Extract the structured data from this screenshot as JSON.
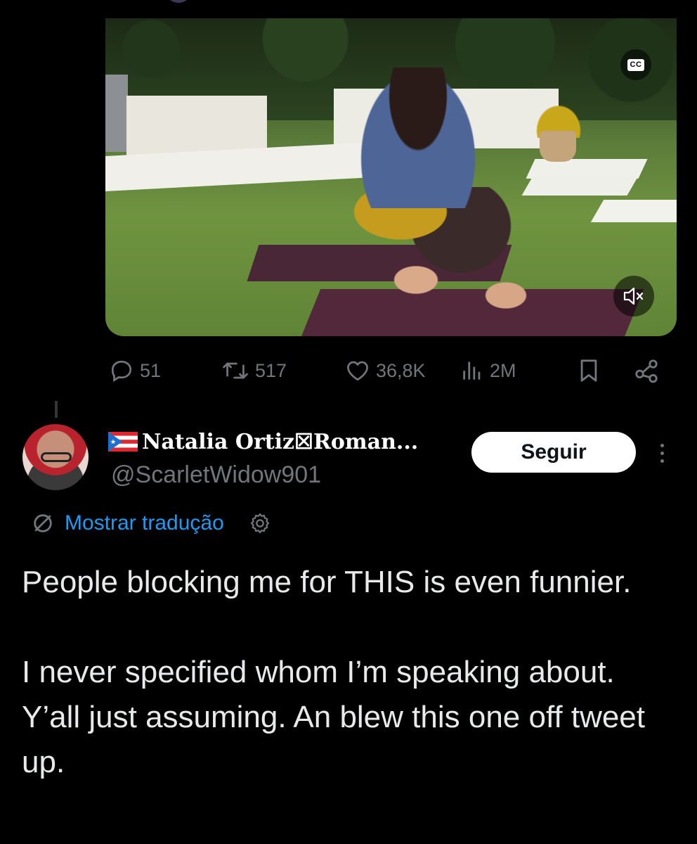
{
  "video": {
    "cc_label": "CC"
  },
  "actions": {
    "replies": "51",
    "reposts": "517",
    "likes": "36,8K",
    "views": "2M"
  },
  "reply": {
    "display_name": "Natalia Ortiz☒Roman...",
    "handle": "@ScarletWidow901",
    "follow_label": "Seguir",
    "translate_label": "Mostrar tradução",
    "text": "People blocking me for THIS is even funnier.\n\nI never specified whom I’m speaking about. Y’all just assuming. An blew this one off tweet up."
  },
  "colors": {
    "background": "#000000",
    "text": "#e7e9ea",
    "muted": "#71767b",
    "link": "#1d9bf0",
    "button_bg": "#ffffff"
  },
  "icons": [
    "cc-icon",
    "mute-icon",
    "reply-icon",
    "retweet-icon",
    "like-icon",
    "views-icon",
    "bookmark-icon",
    "share-icon",
    "puerto-rico-flag-icon",
    "translate-icon",
    "gear-icon",
    "more-icon"
  ]
}
